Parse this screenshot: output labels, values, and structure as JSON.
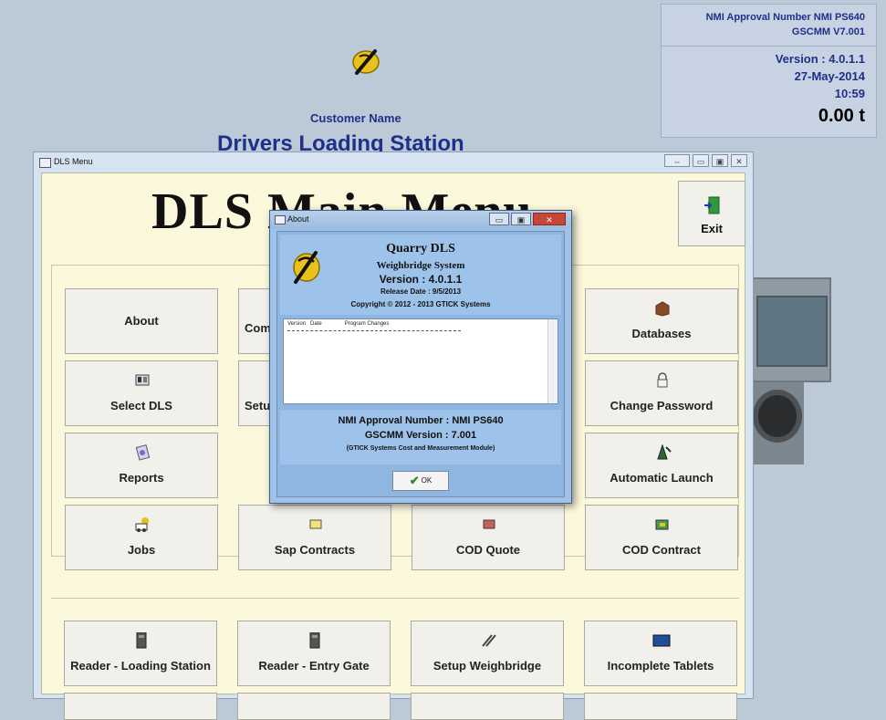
{
  "info_panel": {
    "approval": "NMI Approval Number  NMI PS640",
    "gscmm": "GSCMM V7.001",
    "version": "Version : 4.0.1.1",
    "date": "27-May-2014",
    "time": "10:59",
    "weight": "0.00 t"
  },
  "background": {
    "customer_name": "Customer Name",
    "station_title": "Drivers Loading Station"
  },
  "dls_window": {
    "title": "DLS Menu",
    "main_title": "DLS Main Menu",
    "exit_label": "Exit",
    "tiles": {
      "about": "About",
      "comp": "Comp",
      "databases": "Databases",
      "select_dls": "Select DLS",
      "setup": "Setu",
      "change_password": "Change Password",
      "reports": "Reports",
      "automatic_launch": "Automatic Launch",
      "jobs": "Jobs",
      "sap_contracts": "Sap Contracts",
      "cod_quote": "COD Quote",
      "cod_contract": "COD Contract",
      "reader_loading": "Reader - Loading Station",
      "reader_entry": "Reader - Entry Gate",
      "setup_weighbridge": "Setup Weighbridge",
      "incomplete_tablets": "Incomplete Tablets"
    }
  },
  "about_dialog": {
    "title": "About",
    "app_name": "Quarry DLS",
    "subtitle": "Weighbridge System",
    "version": "Version :  4.0.1.1",
    "release": "Release Date :  9/5/2013",
    "copyright": "Copyright © 2012 - 2013 GTICK Systems",
    "changes_header": "Version   Date               Program Changes",
    "nmi_approval": "NMI Approval Number :  NMI PS640",
    "gscmm_version": "GSCMM Version :  7.001",
    "gscmm_desc": "(GTICK Systems Cost and Measurement Module)",
    "ok_label": "OK"
  }
}
